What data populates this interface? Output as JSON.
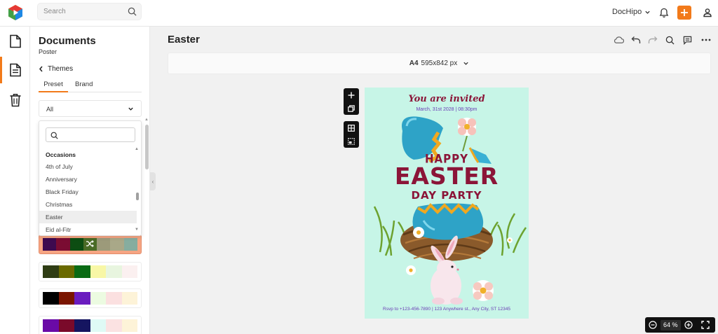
{
  "topbar": {
    "search_placeholder": "Search",
    "brand_menu_label": "DocHipo"
  },
  "rail": {
    "items": [
      "documents-icon",
      "document-text-icon",
      "trash-icon"
    ],
    "active_index": 1
  },
  "panel": {
    "title": "Documents",
    "subtitle": "Poster",
    "back_label": "Themes",
    "tabs": [
      "Preset",
      "Brand"
    ],
    "active_tab": "Preset",
    "select_value": "All",
    "dropdown": {
      "group": "Occasions",
      "items": [
        "4th of July",
        "Anniversary",
        "Black Friday",
        "Christmas",
        "Easter",
        "Eid al-Fitr"
      ],
      "selected": "Easter"
    },
    "palettes": [
      [
        "#3d0a4f",
        "#7a0c32",
        "#0d4d12",
        "#4a6b26",
        "#9c9a7a",
        "#a9a888",
        "#86ad9f"
      ],
      [
        "#2f3d14",
        "#6a6a00",
        "#0a6b14",
        "#f8f7a6",
        "#e8f5df",
        "#fbf0f0"
      ],
      [
        "#000000",
        "#7a1500",
        "#6a1cbf",
        "#ecfbe1",
        "#fbe0e0",
        "#fdf3d8"
      ],
      [
        "#6a0aa6",
        "#7a0a2a",
        "#151560",
        "#dffaf5",
        "#fbe2e2",
        "#fdf3d8"
      ]
    ],
    "active_palette": 0
  },
  "main": {
    "doc_title": "Easter",
    "size_name": "A4",
    "size_dims": "595x842 px"
  },
  "poster": {
    "invite": "You are invited",
    "date_line": "March, 31st 2028  |  08:30pm",
    "happy": "HAPPY",
    "easter": "EASTER",
    "party": "DAY PARTY",
    "rsvp": "Rsvp to +123-456-7890  |  123 Anywhere st., Any City, ST 12345",
    "bg_color": "#c7f5e7",
    "text_color": "#8b1538",
    "accent_color": "#6a3bb5"
  },
  "zoom": {
    "value": "64",
    "unit": "%"
  },
  "colors": {
    "accent": "#f27a1a"
  }
}
